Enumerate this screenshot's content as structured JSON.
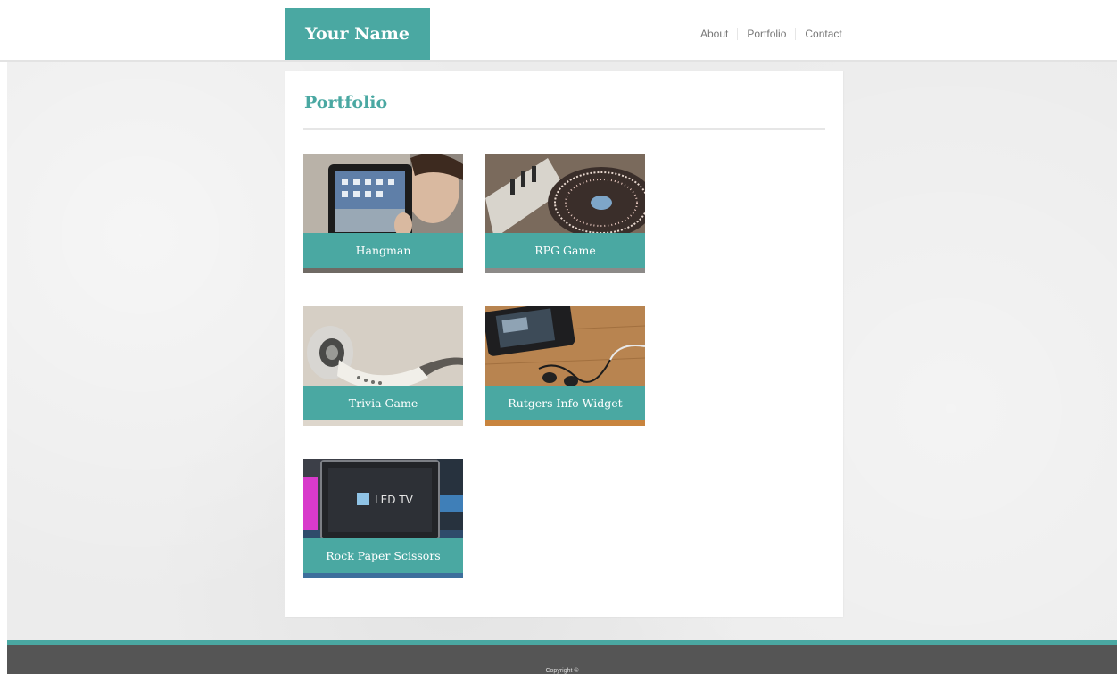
{
  "header": {
    "logo": "Your Name",
    "nav": [
      "About",
      "Portfolio",
      "Contact"
    ]
  },
  "main": {
    "title": "Portfolio",
    "projects": [
      {
        "label": "Hangman",
        "image": "tablet-photo"
      },
      {
        "label": "RPG Game",
        "image": "dj-turntable-photo"
      },
      {
        "label": "Trivia Game",
        "image": "earphones-photo"
      },
      {
        "label": "Rutgers Info Widget",
        "image": "phone-earbuds-photo"
      },
      {
        "label": "Rock Paper Scissors",
        "image": "led-tv-photo"
      }
    ],
    "tv_screen_text": "LED TV"
  },
  "footer": {
    "copyright": "Copyright ©"
  },
  "colors": {
    "accent": "#4aa8a2",
    "footer": "#555555",
    "background": "#ececec"
  }
}
